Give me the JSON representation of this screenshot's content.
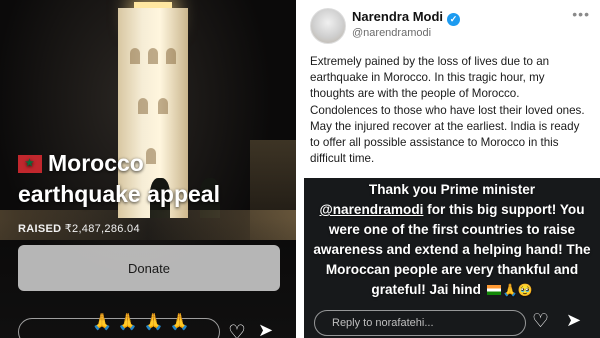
{
  "left_story": {
    "flag_icon": "morocco-flag-icon",
    "title_line1": "Morocco",
    "title_line2": "earthquake appeal",
    "raised_label": "RAISED",
    "raised_amount": "₹2,487,286.04",
    "donate_label": "Donate",
    "reaction_emojis": "🙏🙏🙏🙏"
  },
  "tweet": {
    "author_name": "Narendra Modi",
    "author_handle": "@narendramodi",
    "verified": true,
    "more_label": "•••",
    "text": "Extremely pained by the loss of lives due to an earthquake in Morocco. In this tragic hour, my thoughts are with the people of Morocco. Condolences to those who have lost their loved ones. May the injured recover at the earliest. India is ready to offer all possible assistance to Morocco in this difficult time."
  },
  "right_story": {
    "caption_part1": "Thank you Prime minister",
    "caption_mention": "@narendramodi",
    "caption_part2": " for this big support! You were one of the first countries to raise awareness and extend a helping hand! The Moroccan people are very thankful and grateful! Jai hind ",
    "caption_emojis": "🙏🥹",
    "reply_placeholder": "Reply to norafatehi..."
  },
  "colors": {
    "donate_bg": "#dcdcdc",
    "story_bg": "#17191b",
    "verified_blue": "#1d9bf0"
  }
}
